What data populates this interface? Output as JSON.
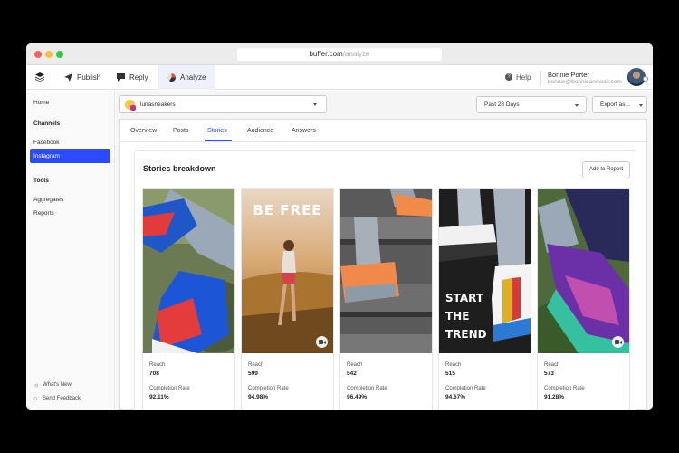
{
  "browser": {
    "url_host": "buffer.com",
    "url_path": "/analyze"
  },
  "topnav": {
    "publish": "Publish",
    "reply": "Reply",
    "analyze": "Analyze",
    "help": "Help",
    "user_name": "Bonnie Porter",
    "user_email": "bonnie@bonnieandwall.com"
  },
  "sidebar": {
    "home": "Home",
    "channels_heading": "Channels",
    "facebook": "Facebook",
    "instagram": "Instagram",
    "tools_heading": "Tools",
    "aggregates": "Aggregates",
    "reports": "Reports",
    "whats_new": "What's New",
    "send_feedback": "Send Feedback"
  },
  "filters": {
    "profile": "lunasneakers",
    "date_range": "Past 28 Days",
    "export": "Export as..."
  },
  "tabs": [
    "Overview",
    "Posts",
    "Stories",
    "Audience",
    "Answers"
  ],
  "active_tab": "Stories",
  "breakdown": {
    "title": "Stories breakdown",
    "add_to_report": "Add to Report",
    "reach_label": "Reach",
    "completion_label": "Completion Rate",
    "cards": [
      {
        "reach": "708",
        "completion": "92.11%",
        "overlay": ""
      },
      {
        "reach": "599",
        "completion": "94.98%",
        "overlay": "BE FREE"
      },
      {
        "reach": "542",
        "completion": "96.49%",
        "overlay": ""
      },
      {
        "reach": "515",
        "completion": "94.67%",
        "overlay": "START THE TREND"
      },
      {
        "reach": "573",
        "completion": "91.28%",
        "overlay": ""
      }
    ]
  },
  "colors": {
    "accent": "#2c4bff"
  }
}
